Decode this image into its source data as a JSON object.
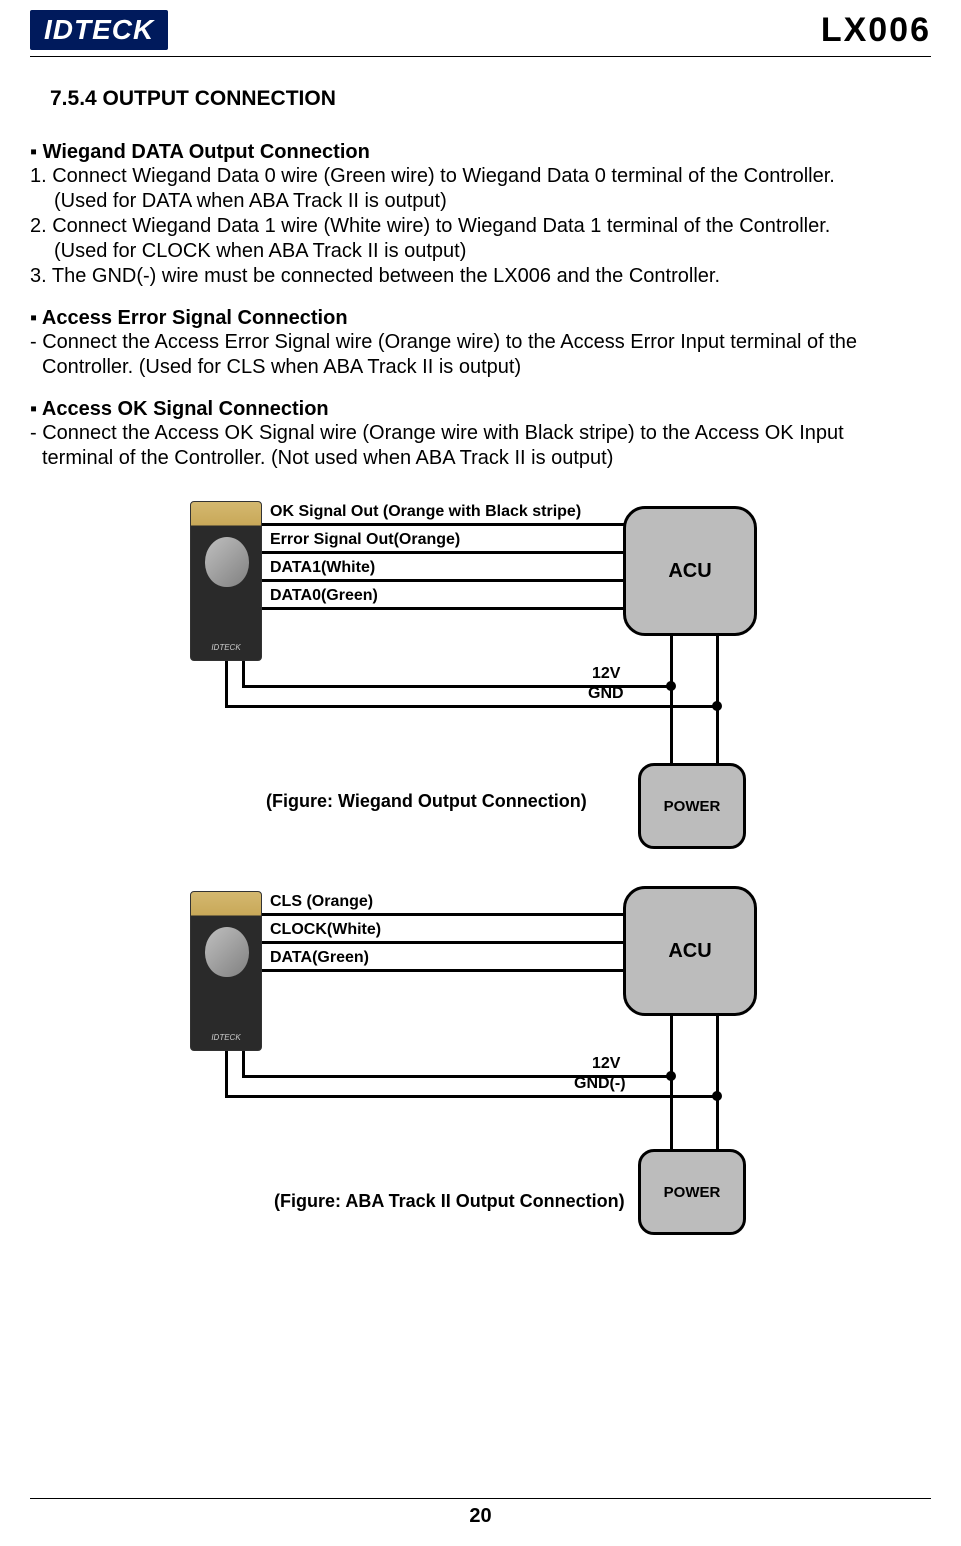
{
  "header": {
    "logo": "IDTECK",
    "model": "LX006"
  },
  "section_title": "7.5.4 OUTPUT CONNECTION",
  "wiegand": {
    "heading": "▪ Wiegand DATA Output Connection",
    "line1": "1. Connect Wiegand Data 0 wire (Green wire) to Wiegand Data 0 terminal of the Controller.",
    "line1b": "(Used for DATA when ABA Track II is output)",
    "line2": "2. Connect Wiegand Data 1 wire (White wire) to Wiegand Data 1 terminal of the Controller.",
    "line2b": "(Used for CLOCK when ABA Track II is output)",
    "line3": "3. The GND(-) wire must be connected between the LX006 and the Controller."
  },
  "access_error": {
    "heading": "▪ Access Error Signal Connection",
    "line1": "- Connect the Access Error Signal wire (Orange wire) to the Access Error Input terminal of the",
    "line2": "Controller. (Used for CLS when ABA Track II is output)"
  },
  "access_ok": {
    "heading": "▪ Access OK Signal Connection",
    "line1": "- Connect the Access OK Signal wire (Orange wire with Black stripe) to the Access OK Input",
    "line2": "terminal of the Controller. (Not used when ABA Track II is output)"
  },
  "diagram1": {
    "wire1": "OK Signal Out (Orange with Black stripe)",
    "wire2": "Error Signal Out(Orange)",
    "wire3": "DATA1(White)",
    "wire4": "DATA0(Green)",
    "v12": "12V",
    "gnd": "GND",
    "acu": "ACU",
    "power": "POWER",
    "caption": "(Figure: Wiegand Output Connection)"
  },
  "diagram2": {
    "wire1": "CLS (Orange)",
    "wire2": "CLOCK(White)",
    "wire3": "DATA(Green)",
    "v12": "12V",
    "gnd": "GND(-)",
    "acu": "ACU",
    "power": "POWER",
    "caption": "(Figure: ABA Track II Output Connection)"
  },
  "page_number": "20"
}
